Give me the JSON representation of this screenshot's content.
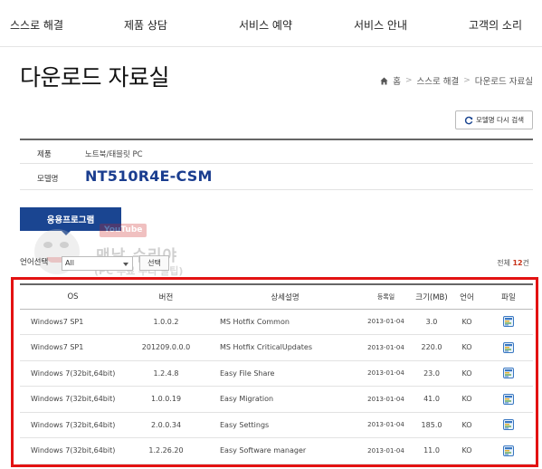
{
  "nav": {
    "items": [
      "스스로 해결",
      "제품 상담",
      "서비스 예약",
      "서비스 안내",
      "고객의 소리"
    ]
  },
  "page": {
    "title": "다운로드 자료실"
  },
  "breadcrumb": {
    "items": [
      "홈",
      "스스로 해결",
      "다운로드 자료실"
    ]
  },
  "model_search_button": "모델명 다시 검색",
  "product_info": {
    "product_label": "제품",
    "product_value": "노트북/태블릿 PC",
    "model_label": "모델명",
    "model_value": "NT510R4E-CSM"
  },
  "tab": {
    "label": "응용프로그램"
  },
  "watermark": {
    "badge": "YouTube",
    "line1": "맨날 수리야",
    "line2": "(PC 무료 수리 꿀팁)"
  },
  "filter": {
    "language_label": "언어선택",
    "language_value": "All",
    "select_button": "선택",
    "total_prefix": "전체",
    "total_count": "12",
    "total_suffix": "건"
  },
  "table": {
    "headers": [
      "OS",
      "버전",
      "상세설명",
      "등록일",
      "크기(MB)",
      "언어",
      "파일"
    ],
    "rows": [
      {
        "os": "Windows7 SP1",
        "version": "1.0.0.2",
        "desc": "MS Hotfix Common",
        "date": "2013-01-04",
        "size": "3.0",
        "lang": "KO"
      },
      {
        "os": "Windows7 SP1",
        "version": "201209.0.0.0",
        "desc": "MS Hotfix CriticalUpdates",
        "date": "2013-01-04",
        "size": "220.0",
        "lang": "KO"
      },
      {
        "os": "Windows 7(32bit,64bit)",
        "version": "1.2.4.8",
        "desc": "Easy File Share",
        "date": "2013-01-04",
        "size": "23.0",
        "lang": "KO"
      },
      {
        "os": "Windows 7(32bit,64bit)",
        "version": "1.0.0.19",
        "desc": "Easy Migration",
        "date": "2013-01-04",
        "size": "41.0",
        "lang": "KO"
      },
      {
        "os": "Windows 7(32bit,64bit)",
        "version": "2.0.0.34",
        "desc": "Easy Settings",
        "date": "2013-01-04",
        "size": "185.0",
        "lang": "KO"
      },
      {
        "os": "Windows 7(32bit,64bit)",
        "version": "1.2.26.20",
        "desc": "Easy Software manager",
        "date": "2013-01-04",
        "size": "11.0",
        "lang": "KO"
      }
    ]
  },
  "colors": {
    "brand_blue": "#1a4591",
    "model_blue": "#1a3d8f",
    "highlight_red": "#e31212"
  }
}
